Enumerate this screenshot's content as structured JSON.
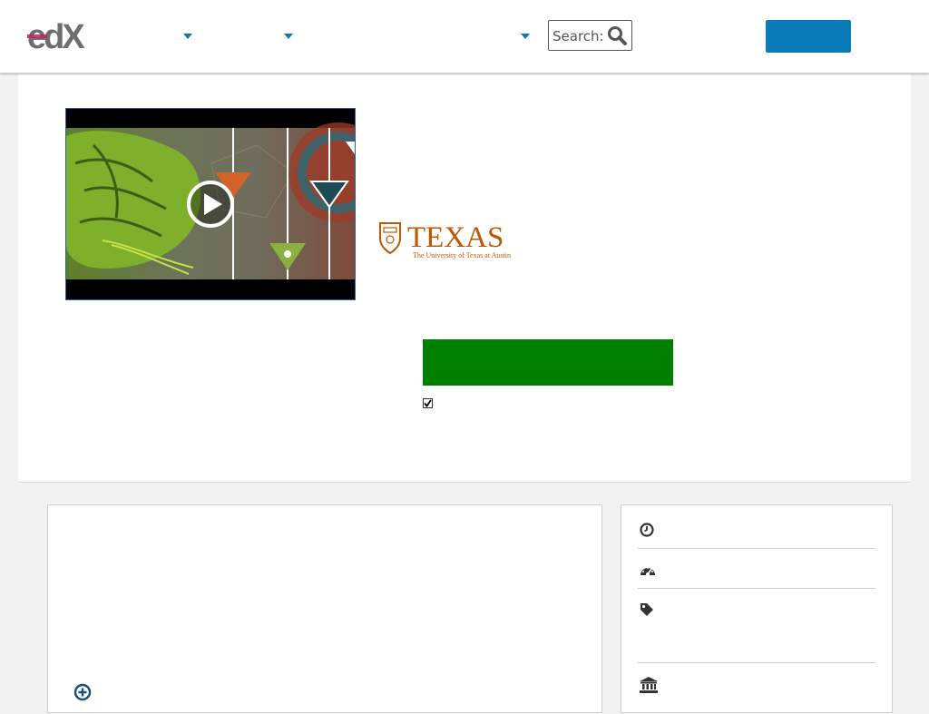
{
  "colors": {
    "accent_blue": "#0a7ab8",
    "enroll_green": "#008000",
    "texas_orange": "#bf5700"
  },
  "header": {
    "logo": {
      "text": "edX"
    },
    "nav_dropdowns": [
      {
        "icon": "caret-down-icon"
      },
      {
        "icon": "caret-down-icon"
      },
      {
        "icon": "caret-down-icon"
      }
    ],
    "search": {
      "placeholder": "Search:",
      "value": "",
      "icon": "search-icon"
    }
  },
  "hero": {
    "video": {
      "icon": "play-icon"
    },
    "school_logo": {
      "name": "TEXAS",
      "subtitle": "The University of Texas at Austin"
    },
    "checkbox": {
      "checked": true
    }
  },
  "course_details": {
    "expand_icon": "plus-circle-icon"
  },
  "quick_facts": [
    {
      "icon": "clock-icon"
    },
    {
      "icon": "gauge-icon"
    },
    {
      "icon": "tag-icon"
    },
    {
      "icon": "institution-icon"
    }
  ]
}
